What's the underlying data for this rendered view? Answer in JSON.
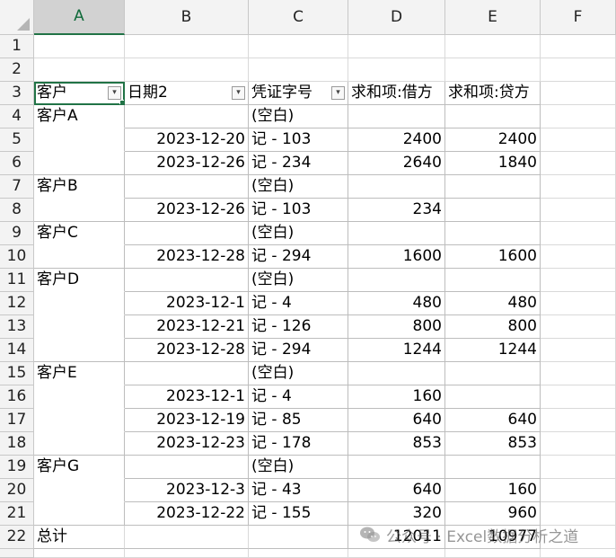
{
  "columns": [
    "A",
    "B",
    "C",
    "D",
    "E",
    "F"
  ],
  "rows": [
    1,
    2,
    3,
    4,
    5,
    6,
    7,
    8,
    9,
    10,
    11,
    12,
    13,
    14,
    15,
    16,
    17,
    18,
    19,
    20,
    21,
    22
  ],
  "pivot": {
    "headers": {
      "customer": "客户",
      "date": "日期2",
      "voucher": "凭证字号",
      "debit": "求和项:借方",
      "credit": "求和项:贷方"
    },
    "blank": "(空白)",
    "customers": [
      {
        "name": "客户A",
        "entries": [
          [
            "2023-12-20",
            "记 - 103",
            "2400",
            "2400"
          ],
          [
            "2023-12-26",
            "记 - 234",
            "2640",
            "1840"
          ]
        ]
      },
      {
        "name": "客户B",
        "entries": [
          [
            "2023-12-26",
            "记 - 103",
            "234",
            ""
          ]
        ]
      },
      {
        "name": "客户C",
        "entries": [
          [
            "2023-12-28",
            "记 - 294",
            "1600",
            "1600"
          ]
        ]
      },
      {
        "name": "客户D",
        "entries": [
          [
            "2023-12-1",
            "记 - 4",
            "480",
            "480"
          ],
          [
            "2023-12-21",
            "记 - 126",
            "800",
            "800"
          ],
          [
            "2023-12-28",
            "记 - 294",
            "1244",
            "1244"
          ]
        ]
      },
      {
        "name": "客户E",
        "entries": [
          [
            "2023-12-1",
            "记 - 4",
            "160",
            ""
          ],
          [
            "2023-12-19",
            "记 - 85",
            "640",
            "640"
          ],
          [
            "2023-12-23",
            "记 - 178",
            "853",
            "853"
          ]
        ]
      },
      {
        "name": "客户G",
        "entries": [
          [
            "2023-12-3",
            "记 - 43",
            "640",
            "160"
          ],
          [
            "2023-12-22",
            "记 - 155",
            "320",
            "960"
          ]
        ]
      }
    ],
    "total": {
      "label": "总计",
      "debit": "12011",
      "credit": "10977"
    }
  },
  "watermark": {
    "text": "公众号 · Excel数据分析之道",
    "icon": "wechat-icon"
  }
}
